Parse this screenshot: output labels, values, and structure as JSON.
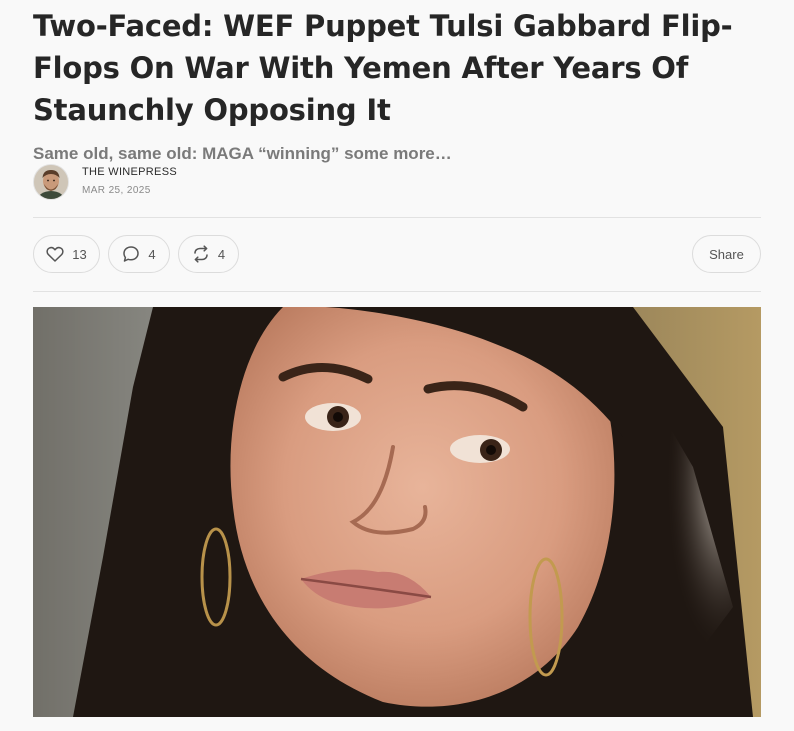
{
  "post": {
    "title": "Two-Faced: WEF Puppet Tulsi Gabbard Flip-Flops On War With Yemen After Years Of Staunchly Opposing It",
    "subtitle": "Same old, same old: MAGA “winning” some more…",
    "author": "THE WINEPRESS",
    "date": "MAR 25, 2025"
  },
  "actions": {
    "like_count": "13",
    "comment_count": "4",
    "restack_count": "4",
    "share_label": "Share"
  },
  "icons": {
    "like": "heart-icon",
    "comment": "comment-bubble-icon",
    "restack": "restack-arrows-icon"
  },
  "colors": {
    "background": "#f9f9f9",
    "title": "#262626",
    "subtitle": "#7a7a7a",
    "divider": "#e2e2e2"
  }
}
